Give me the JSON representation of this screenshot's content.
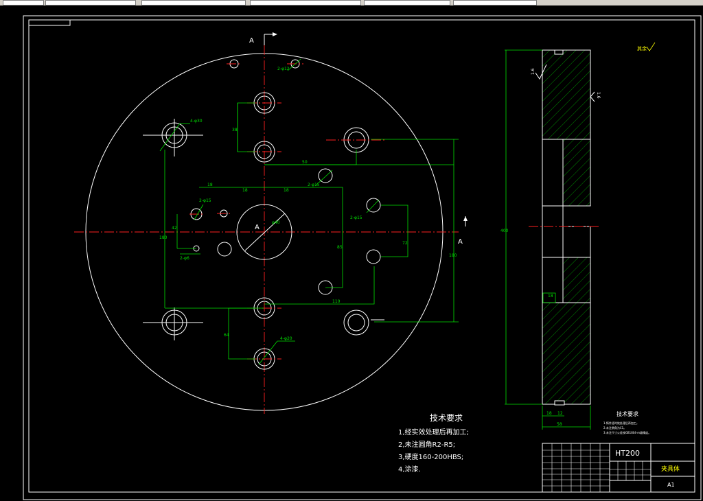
{
  "section_marker": "A",
  "section_label": "A",
  "dimensions": {
    "hole_d20_top_right": "2-φ12",
    "hole_d30": "4-φ30",
    "hole_d15_pair": "2-φ15",
    "hole_d15_mid": "2-φ15",
    "hole_d15_right": "2-φ15",
    "hole_d6": "2-φ6",
    "hole_d20_bottom": "4-φ20",
    "center_bore": "φ40",
    "dim_v1": "38",
    "dim_h1": "50",
    "dim_h2": "18",
    "dim_h3": "18",
    "dim_h4": "18",
    "dim_v2": "42",
    "dim_v3": "180",
    "dim_v4": "85",
    "dim_v5": "72",
    "dim_v6": "180",
    "dim_h5": "110",
    "dim_v7": "64",
    "side_height": "400",
    "side_bottom_a": "18",
    "side_bottom_b": "12",
    "side_bottom_total": "58",
    "side_slot": "18",
    "rough_top": "1.6",
    "rough_right": "1.6",
    "surface_note": "其余"
  },
  "tech_requirements": {
    "title": "技术要求",
    "items": [
      "1,经实效处理后再加工;",
      "2,未注圆角R2-R5;",
      "3,硬度160-200HBS;",
      "4,涂漆."
    ]
  },
  "side_notes": {
    "title": "技术要求",
    "items": [
      "1.铸件经时效处理后再加工。",
      "2.未注倒角为C1。",
      "3.未注尺寸公差按GB1804-m级精度。"
    ]
  },
  "title_block": {
    "material": "HT200",
    "part_name": "夹具体",
    "size": "A1"
  }
}
